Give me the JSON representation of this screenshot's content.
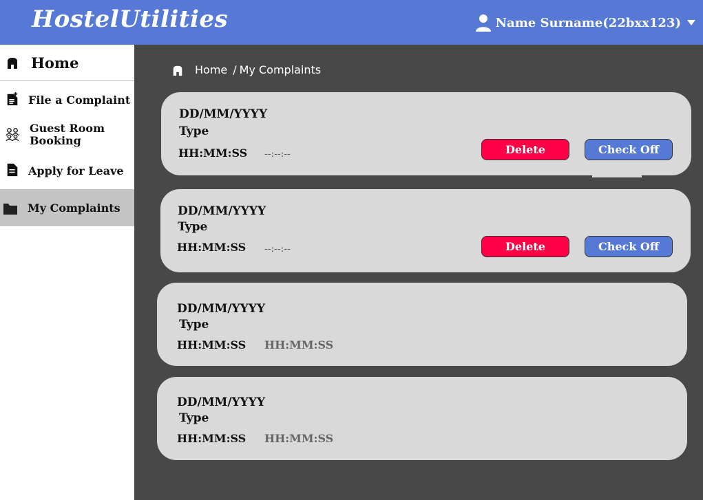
{
  "app": {
    "title": "HostelUtilities"
  },
  "header": {
    "user_name": "Name Surname(22bxx123)"
  },
  "sidebar": {
    "items": [
      {
        "label": "Home",
        "icon": "home-icon"
      },
      {
        "label": "File a Complaint",
        "icon": "file-add-icon"
      },
      {
        "label": "Guest Room Booking",
        "line1": "Guest Room",
        "line2": "Booking",
        "icon": "people-icon"
      },
      {
        "label": "Apply for Leave",
        "icon": "document-icon"
      },
      {
        "label": "My Complaints",
        "icon": "folder-icon",
        "active": true
      }
    ]
  },
  "breadcrumb": {
    "home": "Home",
    "separator": "/",
    "current": "My Complaints"
  },
  "complaints": [
    {
      "date": "DD/MM/YYYY",
      "type": "Type",
      "time": "HH:MM:SS",
      "resolved_time": "--:--:--",
      "delete_label": "Delete",
      "check_label": "Check Off"
    },
    {
      "date": "DD/MM/YYYY",
      "type": "Type",
      "time": "HH:MM:SS",
      "resolved_time": "--:--:--",
      "delete_label": "Delete",
      "check_label": "Check Off"
    },
    {
      "date": "DD/MM/YYYY",
      "type": "Type",
      "time": "HH:MM:SS",
      "resolved_time": "HH:MM:SS"
    },
    {
      "date": "DD/MM/YYYY",
      "type": "Type",
      "time": "HH:MM:SS",
      "resolved_time": "HH:MM:SS"
    }
  ],
  "colors": {
    "header": "#5579d4",
    "background": "#484848",
    "card": "#d9d9d9",
    "delete": "#ff0046",
    "check": "#5579d4"
  }
}
